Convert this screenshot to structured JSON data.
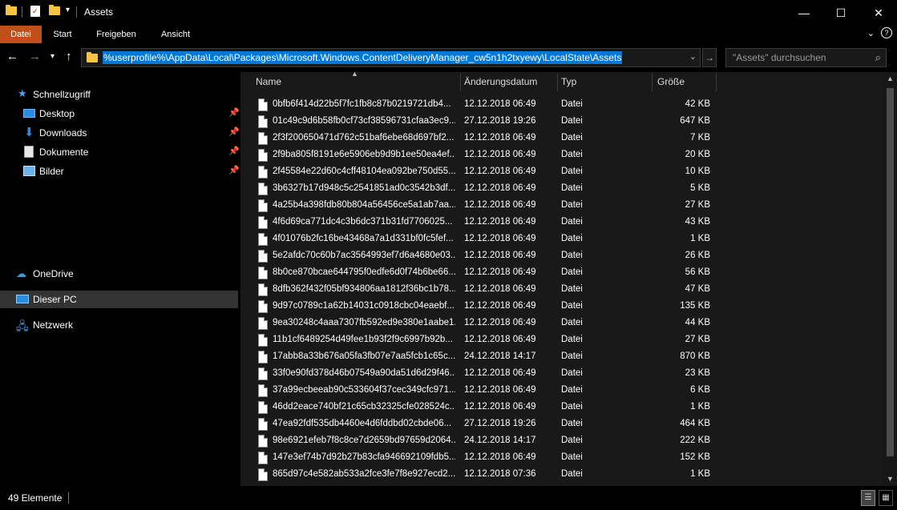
{
  "window": {
    "title": "Assets",
    "minimize": "—",
    "maximize": "☐",
    "close": "✕"
  },
  "ribbon": {
    "tabs": [
      {
        "label": "Datei"
      },
      {
        "label": "Start"
      },
      {
        "label": "Freigeben"
      },
      {
        "label": "Ansicht"
      }
    ],
    "expand_icon": "⌄",
    "help_icon": "?"
  },
  "address": {
    "path": "%userprofile%\\AppData\\Local\\Packages\\Microsoft.Windows.ContentDeliveryManager_cw5n1h2txyewy\\LocalState\\Assets",
    "search_placeholder": "\"Assets\" durchsuchen"
  },
  "navpane": {
    "quick_access": "Schnellzugriff",
    "items": [
      {
        "label": "Desktop"
      },
      {
        "label": "Downloads"
      },
      {
        "label": "Dokumente"
      },
      {
        "label": "Bilder"
      }
    ],
    "onedrive": "OneDrive",
    "this_pc": "Dieser PC",
    "network": "Netzwerk"
  },
  "columns": {
    "name": "Name",
    "date": "Änderungsdatum",
    "type": "Typ",
    "size": "Größe"
  },
  "files": [
    {
      "name": "0bfb6f414d22b5f7fc1fb8c87b0219721db4...",
      "date": "12.12.2018 06:49",
      "type": "Datei",
      "size": "42 KB"
    },
    {
      "name": "01c49c9d6b58fb0cf73cf38596731cfaa3ec9...",
      "date": "27.12.2018 19:26",
      "type": "Datei",
      "size": "647 KB"
    },
    {
      "name": "2f3f200650471d762c51baf6ebe68d697bf2...",
      "date": "12.12.2018 06:49",
      "type": "Datei",
      "size": "7 KB"
    },
    {
      "name": "2f9ba805f8191e6e5906eb9d9b1ee50ea4ef...",
      "date": "12.12.2018 06:49",
      "type": "Datei",
      "size": "20 KB"
    },
    {
      "name": "2f45584e22d60c4cff48104ea092be750d55...",
      "date": "12.12.2018 06:49",
      "type": "Datei",
      "size": "10 KB"
    },
    {
      "name": "3b6327b17d948c5c2541851ad0c3542b3df...",
      "date": "12.12.2018 06:49",
      "type": "Datei",
      "size": "5 KB"
    },
    {
      "name": "4a25b4a398fdb80b804a56456ce5a1ab7aa...",
      "date": "12.12.2018 06:49",
      "type": "Datei",
      "size": "27 KB"
    },
    {
      "name": "4f6d69ca771dc4c3b6dc371b31fd7706025...",
      "date": "12.12.2018 06:49",
      "type": "Datei",
      "size": "43 KB"
    },
    {
      "name": "4f01076b2fc16be43468a7a1d331bf0fc5fef...",
      "date": "12.12.2018 06:49",
      "type": "Datei",
      "size": "1 KB"
    },
    {
      "name": "5e2afdc70c60b7ac3564993ef7d6a4680e03...",
      "date": "12.12.2018 06:49",
      "type": "Datei",
      "size": "26 KB"
    },
    {
      "name": "8b0ce870bcae644795f0edfe6d0f74b6be66...",
      "date": "12.12.2018 06:49",
      "type": "Datei",
      "size": "56 KB"
    },
    {
      "name": "8dfb362f432f05bf934806aa1812f36bc1b78...",
      "date": "12.12.2018 06:49",
      "type": "Datei",
      "size": "47 KB"
    },
    {
      "name": "9d97c0789c1a62b14031c0918cbc04eaebf...",
      "date": "12.12.2018 06:49",
      "type": "Datei",
      "size": "135 KB"
    },
    {
      "name": "9ea30248c4aaa7307fb592ed9e380e1aabe1...",
      "date": "12.12.2018 06:49",
      "type": "Datei",
      "size": "44 KB"
    },
    {
      "name": "11b1cf6489254d49fee1b93f2f9c6997b92b...",
      "date": "12.12.2018 06:49",
      "type": "Datei",
      "size": "27 KB"
    },
    {
      "name": "17abb8a33b676a05fa3fb07e7aa5fcb1c65c...",
      "date": "24.12.2018 14:17",
      "type": "Datei",
      "size": "870 KB"
    },
    {
      "name": "33f0e90fd378d46b07549a90da51d6d29f46...",
      "date": "12.12.2018 06:49",
      "type": "Datei",
      "size": "23 KB"
    },
    {
      "name": "37a99ecbeeab90c533604f37cec349cfc971...",
      "date": "12.12.2018 06:49",
      "type": "Datei",
      "size": "6 KB"
    },
    {
      "name": "46dd2eace740bf21c65cb32325cfe028524c...",
      "date": "12.12.2018 06:49",
      "type": "Datei",
      "size": "1 KB"
    },
    {
      "name": "47ea92fdf535db4460e4d6fddbd02cbde06...",
      "date": "27.12.2018 19:26",
      "type": "Datei",
      "size": "464 KB"
    },
    {
      "name": "98e6921efeb7f8c8ce7d2659bd97659d2064...",
      "date": "24.12.2018 14:17",
      "type": "Datei",
      "size": "222 KB"
    },
    {
      "name": "147e3ef74b7d92b27b83cfa946692109fdb5...",
      "date": "12.12.2018 06:49",
      "type": "Datei",
      "size": "152 KB"
    },
    {
      "name": "865d97c4e582ab533a2fce3fe7f8e927ecd2...",
      "date": "12.12.2018 07:36",
      "type": "Datei",
      "size": "1 KB"
    }
  ],
  "status": {
    "count": "49 Elemente"
  },
  "colors": {
    "accent": "#c0501a",
    "selection": "#0078d7",
    "folder": "#f5c542"
  }
}
